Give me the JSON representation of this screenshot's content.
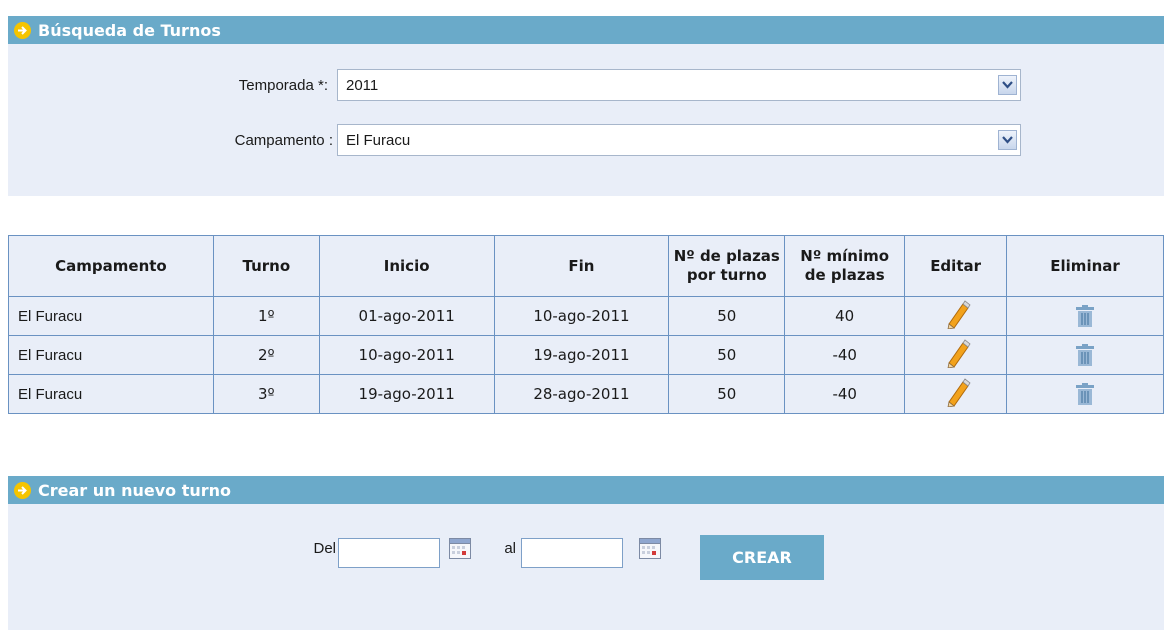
{
  "search_section": {
    "title": "Búsqueda de Turnos",
    "temporada_label": "Temporada *:",
    "temporada_value": "2011",
    "campamento_label": "Campamento :",
    "campamento_value": "El Furacu"
  },
  "table": {
    "headers": [
      "Campamento",
      "Turno",
      "Inicio",
      "Fin",
      "Nº de plazas por turno",
      "Nº mínimo de plazas",
      "Editar",
      "Eliminar"
    ],
    "rows": [
      {
        "campamento": "El Furacu",
        "turno": "1º",
        "inicio": "01-ago-2011",
        "fin": "10-ago-2011",
        "plazas": "50",
        "minimo": "40"
      },
      {
        "campamento": "El Furacu",
        "turno": "2º",
        "inicio": "10-ago-2011",
        "fin": "19-ago-2011",
        "plazas": "50",
        "minimo": "-40"
      },
      {
        "campamento": "El Furacu",
        "turno": "3º",
        "inicio": "19-ago-2011",
        "fin": "28-ago-2011",
        "plazas": "50",
        "minimo": "-40"
      }
    ]
  },
  "create_section": {
    "title": "Crear un nuevo turno",
    "del_label": "Del",
    "al_label": "al",
    "del_value": "",
    "al_value": "",
    "button_label": "CREAR"
  },
  "colors": {
    "header_bar": "#6aaac9",
    "panel_bg": "#e9eef8",
    "table_border": "#6a92c2",
    "arrow_icon": "#f5c400"
  },
  "icons": [
    "arrow-right-icon",
    "chevron-down-icon",
    "pencil-icon",
    "trash-icon",
    "calendar-icon"
  ]
}
